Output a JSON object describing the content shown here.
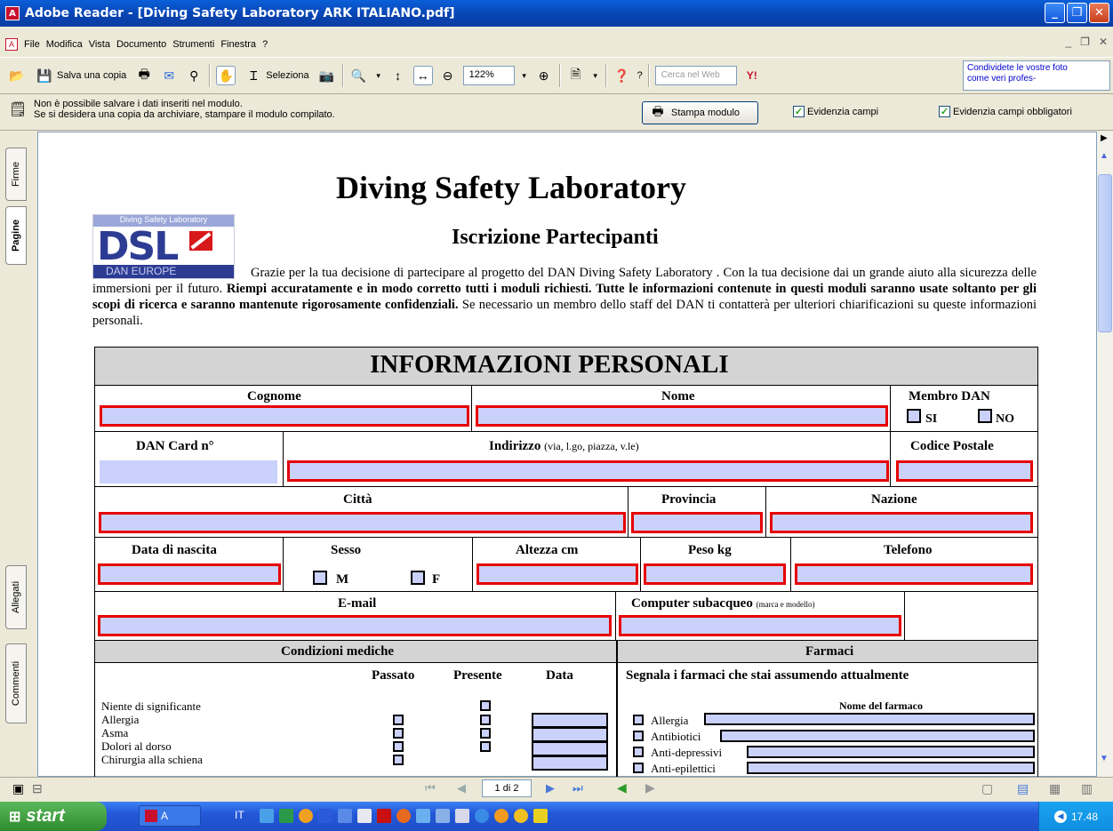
{
  "window": {
    "title": "Adobe Reader - [Diving Safety Laboratory ARK ITALIANO.pdf]",
    "min": "_",
    "max": "❐",
    "close": "✕"
  },
  "menu": [
    "File",
    "Modifica",
    "Vista",
    "Documento",
    "Strumenti",
    "Finestra",
    "?"
  ],
  "toolbar": {
    "save_copy": "Salva una copia",
    "select": "Seleziona",
    "zoom": "122%",
    "search_placeholder": "Cerca nel Web",
    "help": "?",
    "promo": "Condividete le vostre foto come veri profes-"
  },
  "notice": {
    "line1": "Non è possibile salvare i dati inseriti nel modulo.",
    "line2": "Se si desidera una copia da archiviare, stampare il modulo compilato.",
    "print_button": "Stampa modulo",
    "highlight_fields": "Evidenzia campi",
    "highlight_required": "Evidenzia campi obbligatori"
  },
  "side_tabs": {
    "firme": "Firme",
    "pagine": "Pagine",
    "allegati": "Allegati",
    "commenti": "Commenti"
  },
  "doc": {
    "title": "Diving Safety Laboratory",
    "subtitle": "Iscrizione Partecipanti",
    "logo": {
      "top": "Diving Safety Laboratory",
      "mark": "DSL",
      "bottom": "DAN EUROPE"
    },
    "intro_plain": "Grazie per la tua decisione di partecipare al progetto del DAN Diving Safety Laboratory . Con la tua decisione dai un grande aiuto alla sicurezza delle immersioni per il futuro. ",
    "intro_bold": "Riempi accuratamente e in modo corretto tutti i moduli richiesti. Tutte le informazioni contenute in questi moduli saranno usate soltanto per gli scopi di ricerca e saranno mantenute rigorosamente confidenziali.",
    "intro_end": " Se necessario un membro dello staff del DAN ti contatterà per ulteriori chiarificazioni su queste informazioni personali.",
    "section": "INFORMAZIONI PERSONALI",
    "labels": {
      "cognome": "Cognome",
      "nome": "Nome",
      "membro": "Membro DAN",
      "si": "SI",
      "no": "NO",
      "dancard": "DAN Card n°",
      "indirizzo": "Indirizzo",
      "indirizzo_hint": "(via, l.go, piazza, v.le)",
      "cap": "Codice Postale",
      "citta": "Città",
      "provincia": "Provincia",
      "nazione": "Nazione",
      "nascita": "Data di nascita",
      "sesso": "Sesso",
      "m": "M",
      "f": "F",
      "altezza": "Altezza cm",
      "peso": "Peso kg",
      "telefono": "Telefono",
      "email": "E-mail",
      "computer": "Computer subacqueo",
      "computer_hint": "(marca e modello)",
      "condizioni": "Condizioni mediche",
      "farmaci": "Farmaci",
      "passato": "Passato",
      "presente": "Presente",
      "data": "Data",
      "farmaci_intro": "Segnala i farmaci che stai assumendo attualmente",
      "nome_farmaco": "Nome del farmaco"
    },
    "conditions": [
      "Niente di significante",
      "Allergia",
      "Asma",
      "Dolori al dorso",
      "Chirurgia alla schiena"
    ],
    "drugs": [
      "Allergia",
      "Antibiotici",
      "Anti-depressivi",
      "Anti-epilettici"
    ]
  },
  "status": {
    "page": "1 di 2"
  },
  "taskbar": {
    "start": "start",
    "app": "A",
    "lang": "IT",
    "time": "17.48"
  }
}
